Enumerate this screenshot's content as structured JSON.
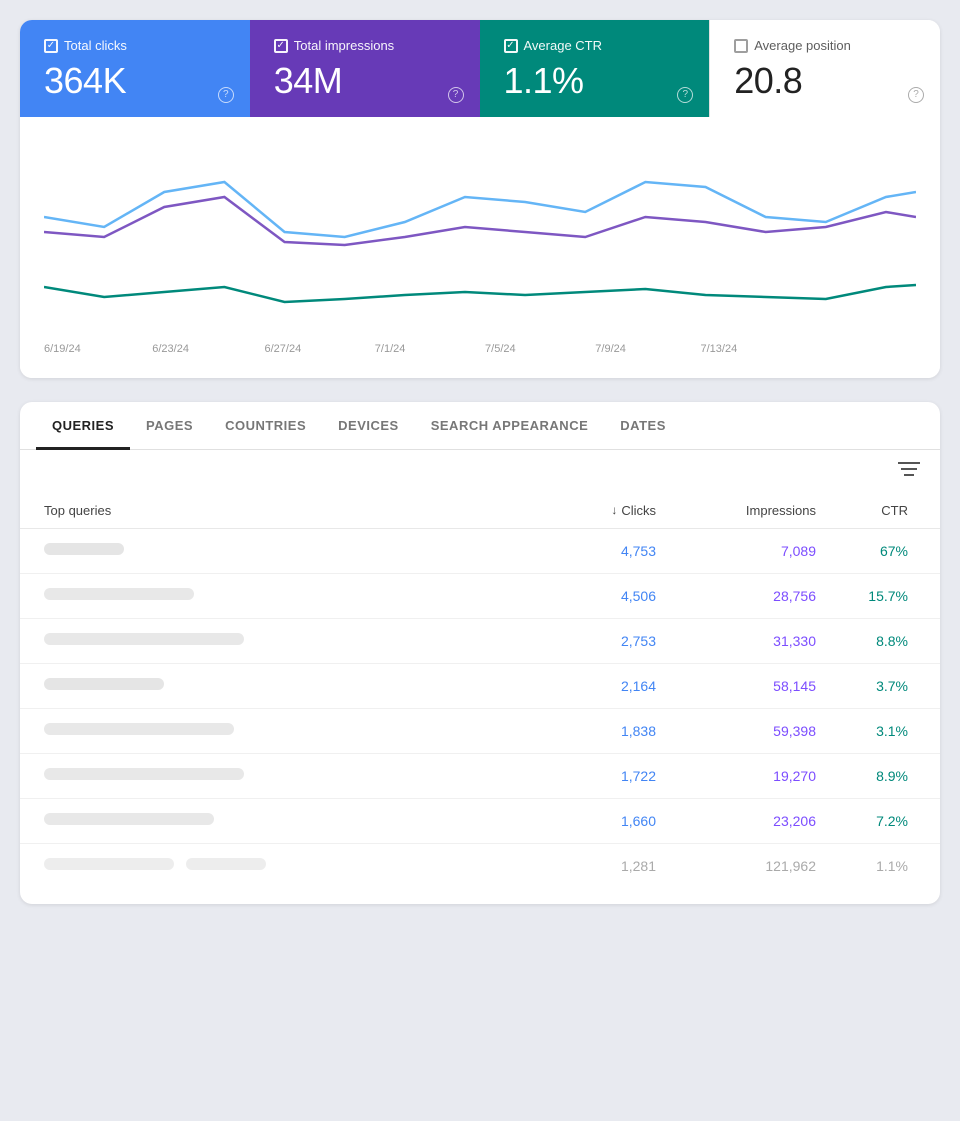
{
  "stats": {
    "clicks": {
      "label": "Total clicks",
      "value": "364K",
      "color": "clicks",
      "checked": true,
      "help": "?"
    },
    "impressions": {
      "label": "Total impressions",
      "value": "34M",
      "color": "impressions",
      "checked": true,
      "help": "?"
    },
    "ctr": {
      "label": "Average CTR",
      "value": "1.1%",
      "color": "ctr",
      "checked": true,
      "help": "?"
    },
    "position": {
      "label": "Average position",
      "value": "20.8",
      "color": "position",
      "checked": false,
      "help": "?"
    }
  },
  "chart": {
    "x_labels": [
      "6/19/24",
      "6/23/24",
      "6/27/24",
      "7/1/24",
      "7/5/24",
      "7/9/24",
      "7/13/24"
    ]
  },
  "tabs": [
    {
      "label": "QUERIES",
      "active": true
    },
    {
      "label": "PAGES",
      "active": false
    },
    {
      "label": "COUNTRIES",
      "active": false
    },
    {
      "label": "DEVICES",
      "active": false
    },
    {
      "label": "SEARCH APPEARANCE",
      "active": false
    },
    {
      "label": "DATES",
      "active": false
    }
  ],
  "table": {
    "headers": {
      "query": "Top queries",
      "clicks": "Clicks",
      "impressions": "Impressions",
      "ctr": "CTR"
    },
    "rows": [
      {
        "blurred_width": 80,
        "clicks": "4,753",
        "impressions": "7,089",
        "ctr": "67%",
        "faded": false
      },
      {
        "blurred_width": 150,
        "clicks": "4,506",
        "impressions": "28,756",
        "ctr": "15.7%",
        "faded": false
      },
      {
        "blurred_width": 200,
        "clicks": "2,753",
        "impressions": "31,330",
        "ctr": "8.8%",
        "faded": false
      },
      {
        "blurred_width": 120,
        "clicks": "2,164",
        "impressions": "58,145",
        "ctr": "3.7%",
        "faded": false
      },
      {
        "blurred_width": 190,
        "clicks": "1,838",
        "impressions": "59,398",
        "ctr": "3.1%",
        "faded": false
      },
      {
        "blurred_width": 200,
        "clicks": "1,722",
        "impressions": "19,270",
        "ctr": "8.9%",
        "faded": false
      },
      {
        "blurred_width": 170,
        "clicks": "1,660",
        "impressions": "23,206",
        "ctr": "7.2%",
        "faded": false
      },
      {
        "blurred_width": 130,
        "clicks": "1,281",
        "impressions": "121,962",
        "ctr": "1.1%",
        "faded": true
      }
    ]
  }
}
